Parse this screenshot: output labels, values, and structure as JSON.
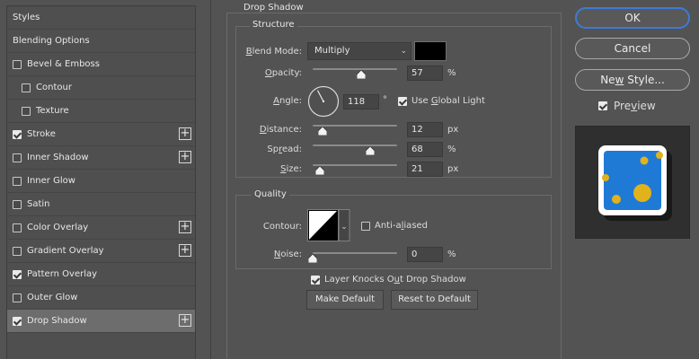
{
  "styles_list": [
    {
      "label": "Styles",
      "header": true,
      "checked": false,
      "has_plus": false,
      "indent": false,
      "selected": false
    },
    {
      "label": "Blending Options",
      "header": true,
      "checked": false,
      "has_plus": false,
      "indent": false,
      "selected": false
    },
    {
      "label": "Bevel & Emboss",
      "header": false,
      "checked": false,
      "has_plus": false,
      "indent": false,
      "selected": false
    },
    {
      "label": "Contour",
      "header": false,
      "checked": false,
      "has_plus": false,
      "indent": true,
      "selected": false
    },
    {
      "label": "Texture",
      "header": false,
      "checked": false,
      "has_plus": false,
      "indent": true,
      "selected": false
    },
    {
      "label": "Stroke",
      "header": false,
      "checked": true,
      "has_plus": true,
      "indent": false,
      "selected": false
    },
    {
      "label": "Inner Shadow",
      "header": false,
      "checked": false,
      "has_plus": true,
      "indent": false,
      "selected": false
    },
    {
      "label": "Inner Glow",
      "header": false,
      "checked": false,
      "has_plus": false,
      "indent": false,
      "selected": false
    },
    {
      "label": "Satin",
      "header": false,
      "checked": false,
      "has_plus": false,
      "indent": false,
      "selected": false
    },
    {
      "label": "Color Overlay",
      "header": false,
      "checked": false,
      "has_plus": true,
      "indent": false,
      "selected": false
    },
    {
      "label": "Gradient Overlay",
      "header": false,
      "checked": false,
      "has_plus": true,
      "indent": false,
      "selected": false
    },
    {
      "label": "Pattern Overlay",
      "header": false,
      "checked": true,
      "has_plus": false,
      "indent": false,
      "selected": false
    },
    {
      "label": "Outer Glow",
      "header": false,
      "checked": false,
      "has_plus": false,
      "indent": false,
      "selected": false
    },
    {
      "label": "Drop Shadow",
      "header": false,
      "checked": true,
      "has_plus": true,
      "indent": false,
      "selected": true
    }
  ],
  "plus_glyph": "+",
  "panel": {
    "title": "Drop Shadow",
    "structure": {
      "legend": "Structure",
      "blend_mode_label_pre": "B",
      "blend_mode_label_rest": "lend Mode:",
      "blend_mode_value": "Multiply",
      "shadow_color": "#000000",
      "opacity_label_pre": "O",
      "opacity_label_rest": "pacity:",
      "opacity_value": "57",
      "opacity_fraction": 0.57,
      "opacity_unit": "%",
      "angle_label_pre": "A",
      "angle_label_rest": "ngle:",
      "angle_value": "118",
      "angle_degrees": 118,
      "angle_unit": "°",
      "use_global_light_pre": "Use ",
      "use_global_light_u": "G",
      "use_global_light_rest": "lobal Light",
      "use_global_light_checked": true,
      "distance_label_pre": "D",
      "distance_label_rest": "istance:",
      "distance_value": "12",
      "distance_fraction": 0.12,
      "distance_unit": "px",
      "spread_label_pre": "Sp",
      "spread_label_u": "r",
      "spread_label_rest": "ead:",
      "spread_value": "68",
      "spread_fraction": 0.68,
      "spread_unit": "%",
      "size_label_pre": "S",
      "size_label_rest": "ize:",
      "size_value": "21",
      "size_fraction": 0.08,
      "size_unit": "px"
    },
    "quality": {
      "legend": "Quality",
      "contour_label": "Contour:",
      "anti_aliased_pre": "Anti-a",
      "anti_aliased_u": "l",
      "anti_aliased_rest": "iased",
      "anti_aliased_checked": false,
      "noise_label_pre": "N",
      "noise_label_rest": "oise:",
      "noise_value": "0",
      "noise_fraction": 0,
      "noise_unit": "%"
    },
    "layer_knocks_out_pre": "Layer Knocks O",
    "layer_knocks_out_u": "u",
    "layer_knocks_out_rest": "t Drop Shadow",
    "layer_knocks_out_checked": true,
    "make_default_label": "Make Default",
    "reset_default_label": "Reset to Default"
  },
  "right": {
    "ok_label": "OK",
    "cancel_label": "Cancel",
    "new_style_pre": "Ne",
    "new_style_u": "w",
    "new_style_rest": " Style...",
    "preview_pre": "Pre",
    "preview_u": "v",
    "preview_rest": "iew",
    "preview_checked": true,
    "preview_colors": {
      "fill": "#1f7ad6",
      "dots": "#e2b21c",
      "frame": "#ffffff"
    }
  }
}
